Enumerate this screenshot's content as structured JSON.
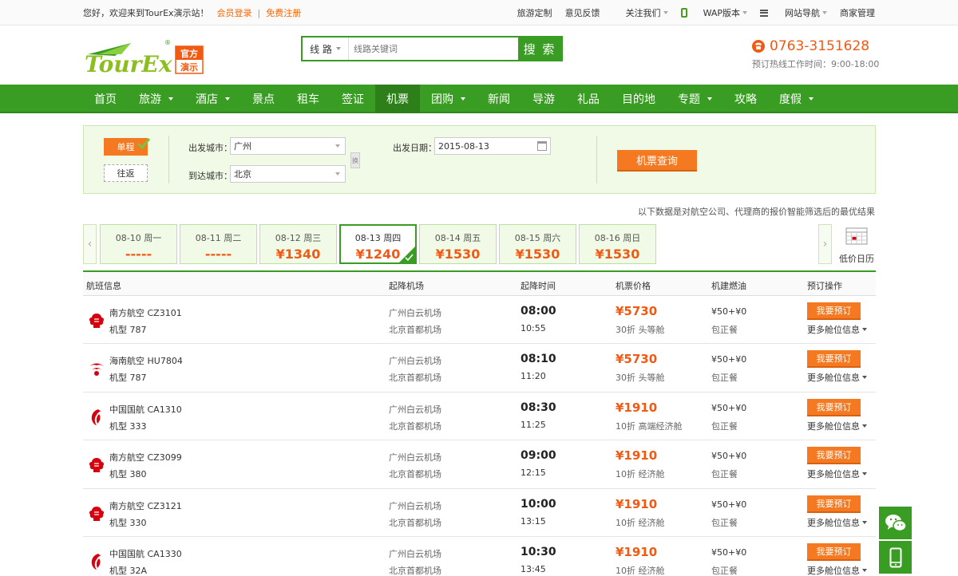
{
  "topbar": {
    "welcome": "您好，欢迎来到TourEx演示站！",
    "login": "会员登录",
    "sep": "|",
    "register": "免费注册",
    "links": [
      "旅游定制",
      "意见反馈",
      "关注我们",
      "WAP版本",
      "网站导航",
      "商家管理"
    ]
  },
  "logo": {
    "text": "TourEx",
    "badge_top": "官方",
    "badge_bottom": "演示",
    "reg": "®"
  },
  "search": {
    "type": "线  路",
    "placeholder": "线路关键词",
    "button": "搜 索"
  },
  "hotline": {
    "number": "0763-3151628",
    "hours": "预订热线工作时间：9:00-18:00"
  },
  "nav": {
    "items": [
      {
        "label": "首页",
        "dropdown": false
      },
      {
        "label": "旅游",
        "dropdown": true
      },
      {
        "label": "酒店",
        "dropdown": true
      },
      {
        "label": "景点",
        "dropdown": false
      },
      {
        "label": "租车",
        "dropdown": false
      },
      {
        "label": "签证",
        "dropdown": false
      },
      {
        "label": "机票",
        "dropdown": false,
        "active": true
      },
      {
        "label": "团购",
        "dropdown": true
      },
      {
        "label": "新闻",
        "dropdown": false
      },
      {
        "label": "导游",
        "dropdown": false
      },
      {
        "label": "礼品",
        "dropdown": false
      },
      {
        "label": "目的地",
        "dropdown": false
      },
      {
        "label": "专题",
        "dropdown": true
      },
      {
        "label": "攻略",
        "dropdown": false
      },
      {
        "label": "度假",
        "dropdown": true
      }
    ]
  },
  "panel": {
    "one_way": "单程",
    "round_trip": "往返",
    "from_label": "出发城市：",
    "from_value": "广州",
    "to_label": "到达城市：",
    "to_value": "北京",
    "swap": "换",
    "date_label": "出发日期：",
    "date_value": "2015-08-13",
    "query_button": "机票查询"
  },
  "note": "以下数据是对航空公司、代理商的报价智能筛选后的最优结果",
  "date_strip": {
    "cells": [
      {
        "date": "08-10 周一",
        "price": "-----"
      },
      {
        "date": "08-11 周二",
        "price": "-----"
      },
      {
        "date": "08-12 周三",
        "price": "¥1340"
      },
      {
        "date": "08-13 周四",
        "price": "¥1240",
        "selected": true
      },
      {
        "date": "08-14 周五",
        "price": "¥1530"
      },
      {
        "date": "08-15 周六",
        "price": "¥1530"
      },
      {
        "date": "08-16 周日",
        "price": "¥1530"
      }
    ],
    "low_calendar": "低价日历"
  },
  "table": {
    "headers": [
      "航班信息",
      "起降机场",
      "起降时间",
      "机票价格",
      "机建燃油",
      "预订操作"
    ],
    "book_label": "我要预订",
    "more_label": "更多舱位信息",
    "rows": [
      {
        "airline": "南方航空 CZ3101",
        "model": "机型 787",
        "dep_airport": "广州白云机场",
        "arr_airport": "北京首都机场",
        "dep_time": "08:00",
        "arr_time": "10:55",
        "price": "¥5730",
        "cabin": "30折 头等舱",
        "tax": "¥50+¥0",
        "meal": "包正餐",
        "logo": "southern-airlines",
        "logo_color": "#d7000f"
      },
      {
        "airline": "海南航空 HU7804",
        "model": "机型 787",
        "dep_airport": "广州白云机场",
        "arr_airport": "北京首都机场",
        "dep_time": "08:10",
        "arr_time": "11:20",
        "price": "¥5730",
        "cabin": "30折 头等舱",
        "tax": "¥50+¥0",
        "meal": "包正餐",
        "logo": "hainan-airlines",
        "logo_color": "#d7000f"
      },
      {
        "airline": "中国国航 CA1310",
        "model": "机型 333",
        "dep_airport": "广州白云机场",
        "arr_airport": "北京首都机场",
        "dep_time": "08:30",
        "arr_time": "11:25",
        "price": "¥1910",
        "cabin": "10折 高端经济舱",
        "tax": "¥50+¥0",
        "meal": "包正餐",
        "logo": "air-china",
        "logo_color": "#d7000f"
      },
      {
        "airline": "南方航空 CZ3099",
        "model": "机型 380",
        "dep_airport": "广州白云机场",
        "arr_airport": "北京首都机场",
        "dep_time": "09:00",
        "arr_time": "12:15",
        "price": "¥1910",
        "cabin": "10折 经济舱",
        "tax": "¥50+¥0",
        "meal": "包正餐",
        "logo": "southern-airlines",
        "logo_color": "#d7000f"
      },
      {
        "airline": "南方航空 CZ3121",
        "model": "机型 330",
        "dep_airport": "广州白云机场",
        "arr_airport": "北京首都机场",
        "dep_time": "10:00",
        "arr_time": "13:15",
        "price": "¥1910",
        "cabin": "10折 经济舱",
        "tax": "¥50+¥0",
        "meal": "包正餐",
        "logo": "southern-airlines",
        "logo_color": "#d7000f"
      },
      {
        "airline": "中国国航 CA1330",
        "model": "机型 32A",
        "dep_airport": "广州白云机场",
        "arr_airport": "北京首都机场",
        "dep_time": "10:30",
        "arr_time": "13:45",
        "price": "¥1910",
        "cabin": "10折 经济舱",
        "tax": "¥50+¥0",
        "meal": "包正餐",
        "logo": "air-china",
        "logo_color": "#d7000f"
      }
    ]
  },
  "floats": [
    "wechat-icon",
    "mobile-icon"
  ],
  "colors": {
    "brand_green": "#3a9d23",
    "accent_orange": "#f47920",
    "price_orange": "#f05a12"
  }
}
